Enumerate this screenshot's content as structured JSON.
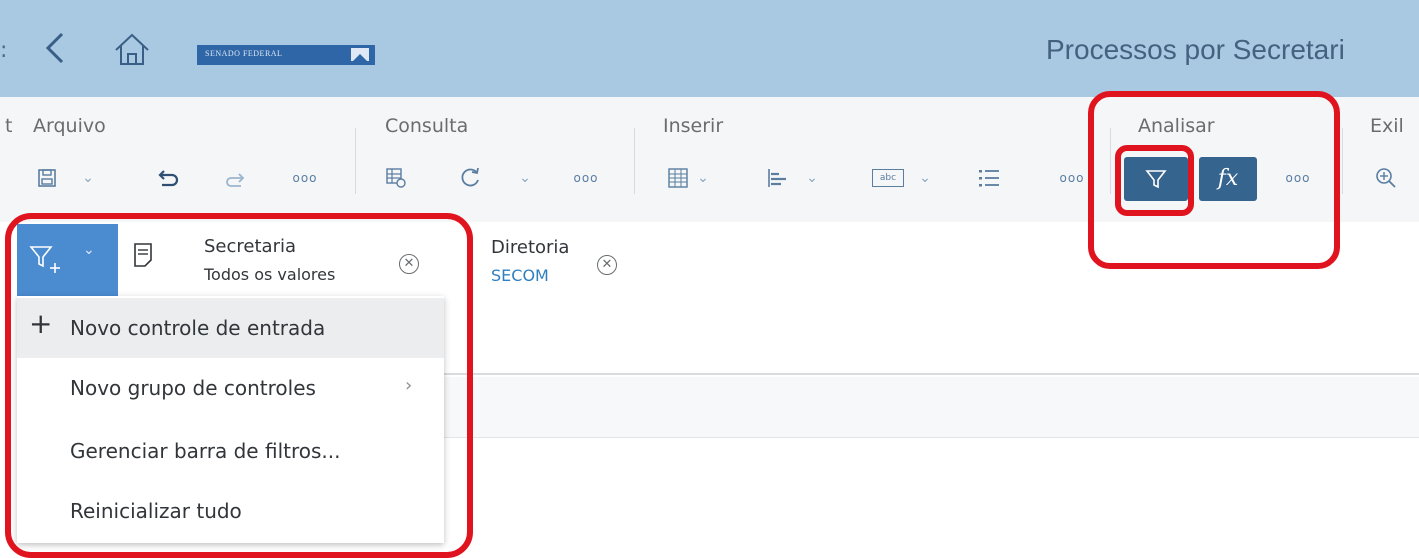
{
  "shell": {
    "left_fragment": ":",
    "logo_text": "SENADO FEDERAL",
    "title": "Processos por Secretari"
  },
  "toolbar": {
    "left_fragment": "t",
    "groups": {
      "arquivo": "Arquivo",
      "consulta": "Consulta",
      "inserir": "Inserir",
      "analisar": "Analisar",
      "exibir": "Exil"
    },
    "icons": {
      "save": "save-icon",
      "undo": "undo-icon",
      "redo": "redo-icon",
      "more": "more-icon",
      "query_grid": "query-grid-icon",
      "refresh": "refresh-icon",
      "table": "table-icon",
      "chart": "chart-icon",
      "text": "text-box-icon",
      "list": "list-icon",
      "filter": "filter-icon",
      "formula": "formula-icon",
      "zoom": "zoom-in-icon"
    },
    "text_icon_label": "abc",
    "formula_label": "fx"
  },
  "filters": [
    {
      "title": "Secretaria",
      "value": "Todos os valores"
    },
    {
      "title": "Diretoria",
      "value": "SECOM"
    }
  ],
  "menu": {
    "items": [
      {
        "label": "Novo controle de entrada"
      },
      {
        "label": "Novo grupo de controles"
      },
      {
        "label": "Gerenciar barra de filtros..."
      },
      {
        "label": "Reinicializar tudo"
      }
    ]
  },
  "colors": {
    "shell": "#a9c8e2",
    "accent": "#35648f",
    "filter_button": "#4b8bd0",
    "annotation": "#e0141e",
    "sub_value": "#2f7fc1"
  }
}
